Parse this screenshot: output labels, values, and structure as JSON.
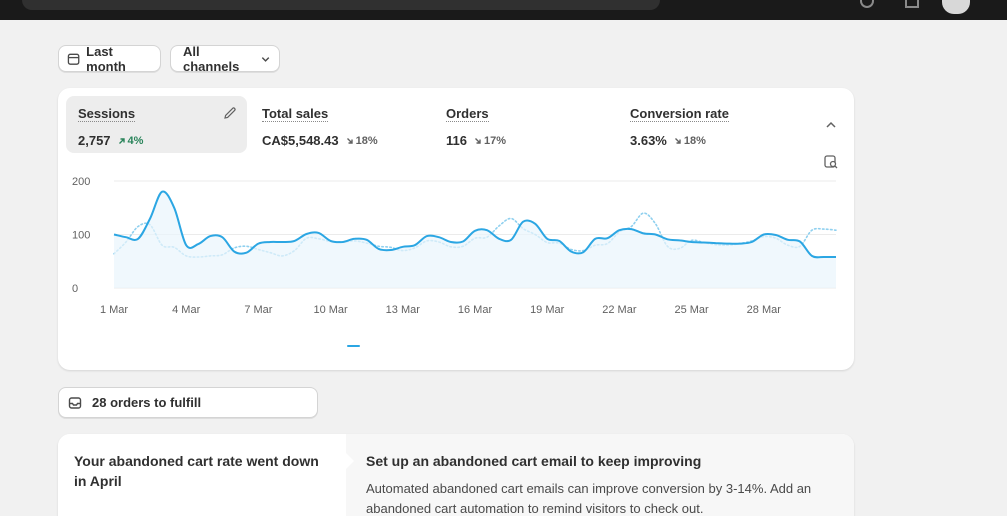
{
  "filters": {
    "period_label": "Last month",
    "channels_label": "All channels"
  },
  "metrics": [
    {
      "label": "Sessions",
      "value": "2,757",
      "delta": "4%",
      "direction": "up"
    },
    {
      "label": "Total sales",
      "value": "CA$5,548.43",
      "delta": "18%",
      "direction": "down"
    },
    {
      "label": "Orders",
      "value": "116",
      "delta": "17%",
      "direction": "down"
    },
    {
      "label": "Conversion rate",
      "value": "3.63%",
      "delta": "18%",
      "direction": "down"
    }
  ],
  "chart_data": {
    "type": "line",
    "ylim": [
      0,
      200
    ],
    "y_ticks": [
      "200",
      "100",
      "0"
    ],
    "x_tick_labels": [
      "1 Mar",
      "4 Mar",
      "7 Mar",
      "10 Mar",
      "13 Mar",
      "16 Mar",
      "19 Mar",
      "22 Mar",
      "25 Mar",
      "28 Mar"
    ],
    "x": [
      1,
      1.5,
      2,
      2.5,
      3,
      3.5,
      4,
      4.5,
      5,
      5.5,
      6,
      6.5,
      7,
      7.5,
      8,
      8.5,
      9,
      9.5,
      10,
      10.5,
      11,
      11.5,
      12,
      12.5,
      13,
      13.5,
      14,
      14.5,
      15,
      15.5,
      16,
      16.5,
      17,
      17.5,
      18,
      18.5,
      19,
      19.5,
      20,
      20.5,
      21,
      21.5,
      22,
      22.5,
      23,
      23.5,
      24,
      24.5,
      25,
      25.5,
      26,
      26.5,
      27,
      27.5,
      28,
      28.5,
      29,
      29.5,
      30,
      30.5,
      31
    ],
    "series": [
      {
        "values": [
          100,
          95,
          92,
          130,
          180,
          150,
          80,
          82,
          97,
          95,
          68,
          66,
          83,
          86,
          86,
          88,
          101,
          103,
          88,
          86,
          92,
          90,
          73,
          71,
          77,
          80,
          97,
          95,
          86,
          87,
          107,
          108,
          92,
          90,
          124,
          120,
          92,
          88,
          68,
          67,
          92,
          93,
          108,
          110,
          102,
          100,
          91,
          89,
          86,
          85,
          84,
          83,
          83,
          86,
          100,
          99,
          90,
          87,
          60,
          58,
          58
        ],
        "style": "solid",
        "color": "#2ba6e3"
      },
      {
        "values": [
          64,
          86,
          115,
          118,
          80,
          76,
          60,
          58,
          60,
          62,
          75,
          78,
          72,
          66,
          60,
          70,
          93,
          92,
          87,
          86,
          88,
          84,
          78,
          76,
          70,
          75,
          88,
          86,
          77,
          78,
          93,
          95,
          116,
          130,
          111,
          100,
          85,
          84,
          72,
          70,
          80,
          83,
          105,
          115,
          140,
          120,
          78,
          74,
          89,
          85,
          81,
          80,
          83,
          88,
          96,
          93,
          80,
          78,
          108,
          110,
          108
        ],
        "style": "dotted",
        "color": "#8fd0ef"
      }
    ]
  },
  "fulfill": {
    "label": "28 orders to fulfill"
  },
  "abandoned_cart": {
    "headline": "Your abandoned cart rate went down in April",
    "title": "Set up an abandoned cart email to keep improving",
    "body": "Automated abandoned cart emails can improve conversion by 3-14%. Add an abandoned cart automation to remind visitors to check out."
  },
  "colors": {
    "accent": "#2ba6e3",
    "up": "#29845a",
    "down": "#616161"
  }
}
